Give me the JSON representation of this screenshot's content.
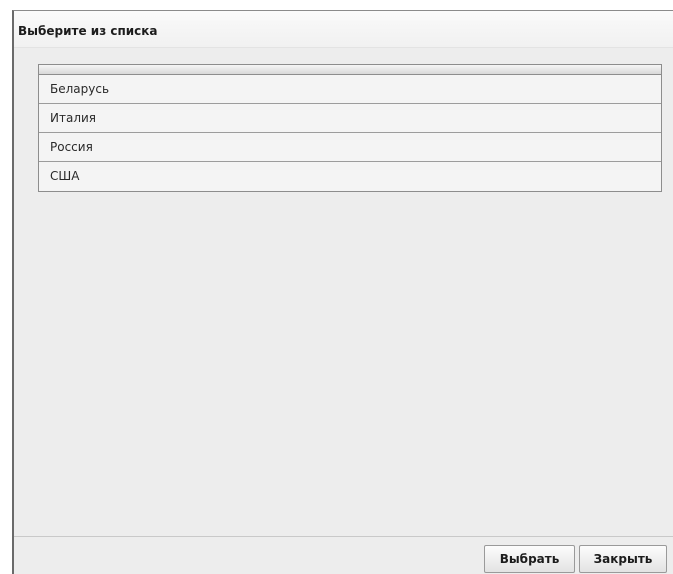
{
  "dialog": {
    "title": "Выберите из списка"
  },
  "list": {
    "items": [
      {
        "label": "Беларусь"
      },
      {
        "label": "Италия"
      },
      {
        "label": "Россия"
      },
      {
        "label": "США"
      }
    ]
  },
  "footer": {
    "select_label": "Выбрать",
    "close_label": "Закрыть"
  }
}
